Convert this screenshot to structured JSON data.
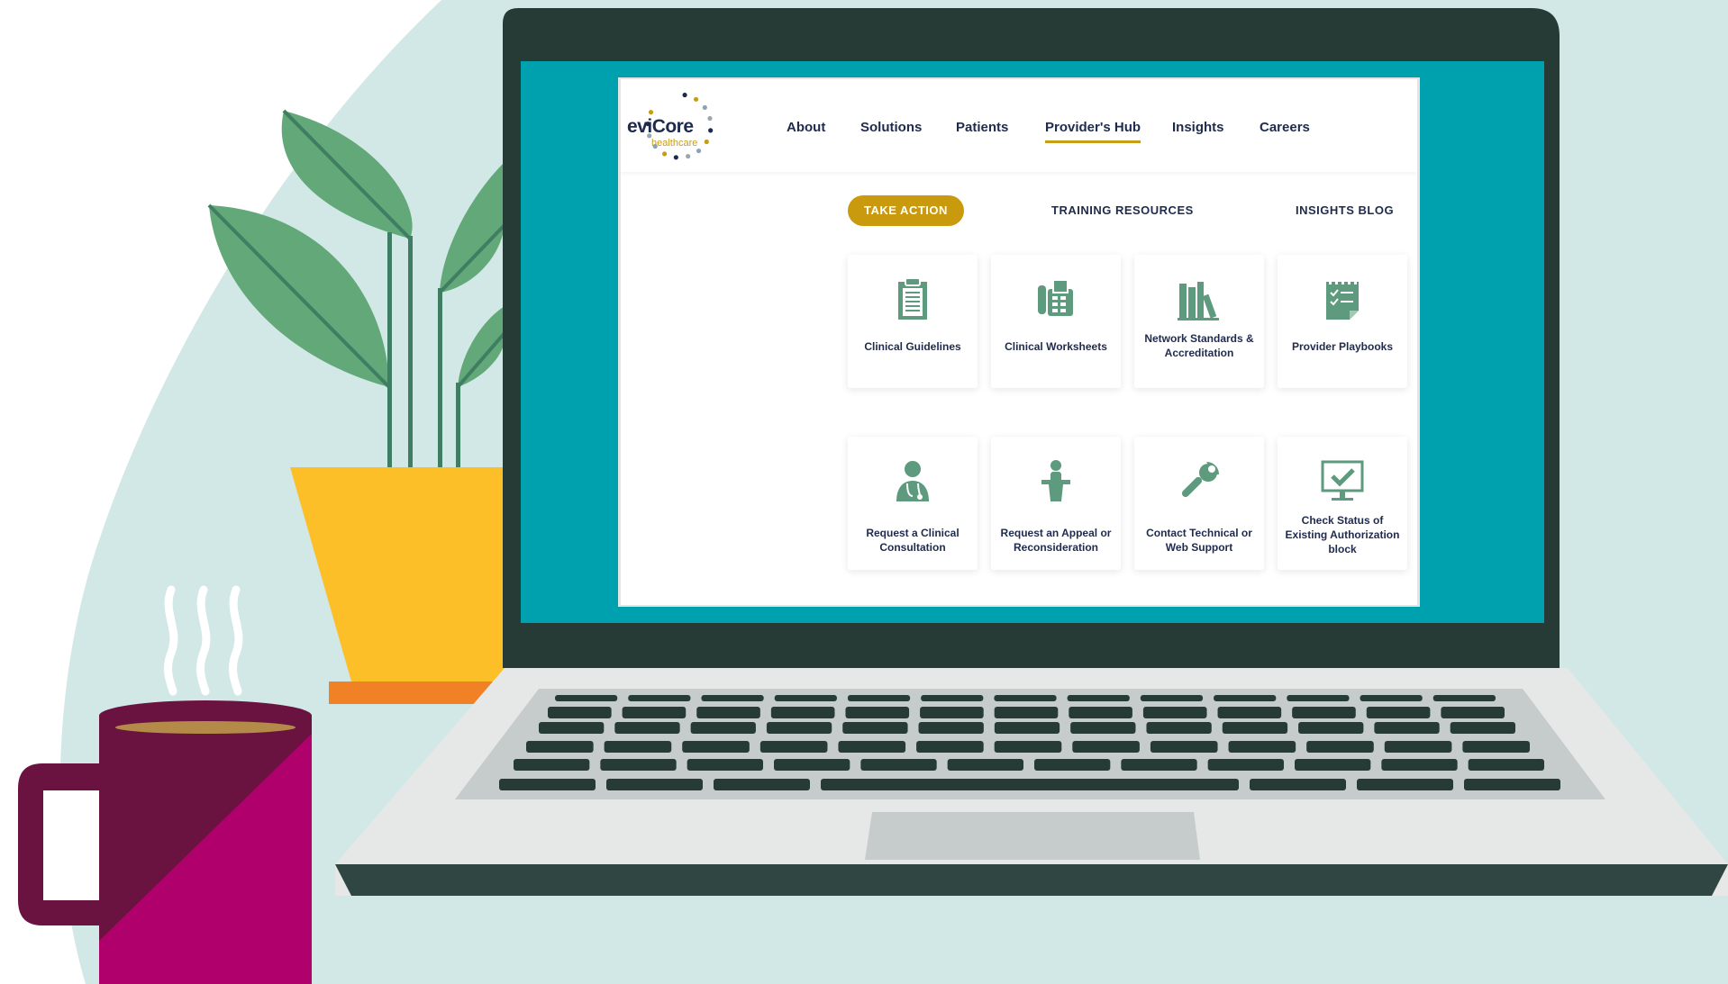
{
  "logo": {
    "word": "eviCore",
    "sub": "healthcare"
  },
  "nav": {
    "items": [
      {
        "label": "About"
      },
      {
        "label": "Solutions"
      },
      {
        "label": "Patients"
      },
      {
        "label": "Provider's Hub"
      },
      {
        "label": "Insights"
      },
      {
        "label": "Careers"
      }
    ],
    "active": "Provider's Hub"
  },
  "subnav": {
    "take_action": "TAKE ACTION",
    "training": "TRAINING RESOURCES",
    "blog": "INSIGHTS BLOG"
  },
  "cards": [
    {
      "label": "Clinical Guidelines",
      "icon": "clipboard-icon"
    },
    {
      "label": "Clinical Worksheets",
      "icon": "fax-machine-icon"
    },
    {
      "label": "Network Standards & Accreditation",
      "icon": "books-icon"
    },
    {
      "label": "Provider Playbooks",
      "icon": "checklist-notepad-icon"
    },
    {
      "label": "Request a Clinical Consultation",
      "icon": "doctor-icon"
    },
    {
      "label": "Request an Appeal or Reconsideration",
      "icon": "speaker-podium-icon"
    },
    {
      "label": "Contact Technical or Web Support",
      "icon": "wrench-icon"
    },
    {
      "label": "Check Status of Existing Authorization block",
      "icon": "monitor-check-icon"
    }
  ],
  "colors": {
    "teal_screen": "#00a1ae",
    "laptop_frame": "#273b36",
    "navy_text": "#1f2b4d",
    "gold_accent": "#c99a0e",
    "icon_green": "#5e9a7d",
    "leaf_green": "#62a878",
    "pot_yellow": "#fdbf27",
    "mug_purple": "#6a1240",
    "mug_magenta": "#b0006b"
  }
}
